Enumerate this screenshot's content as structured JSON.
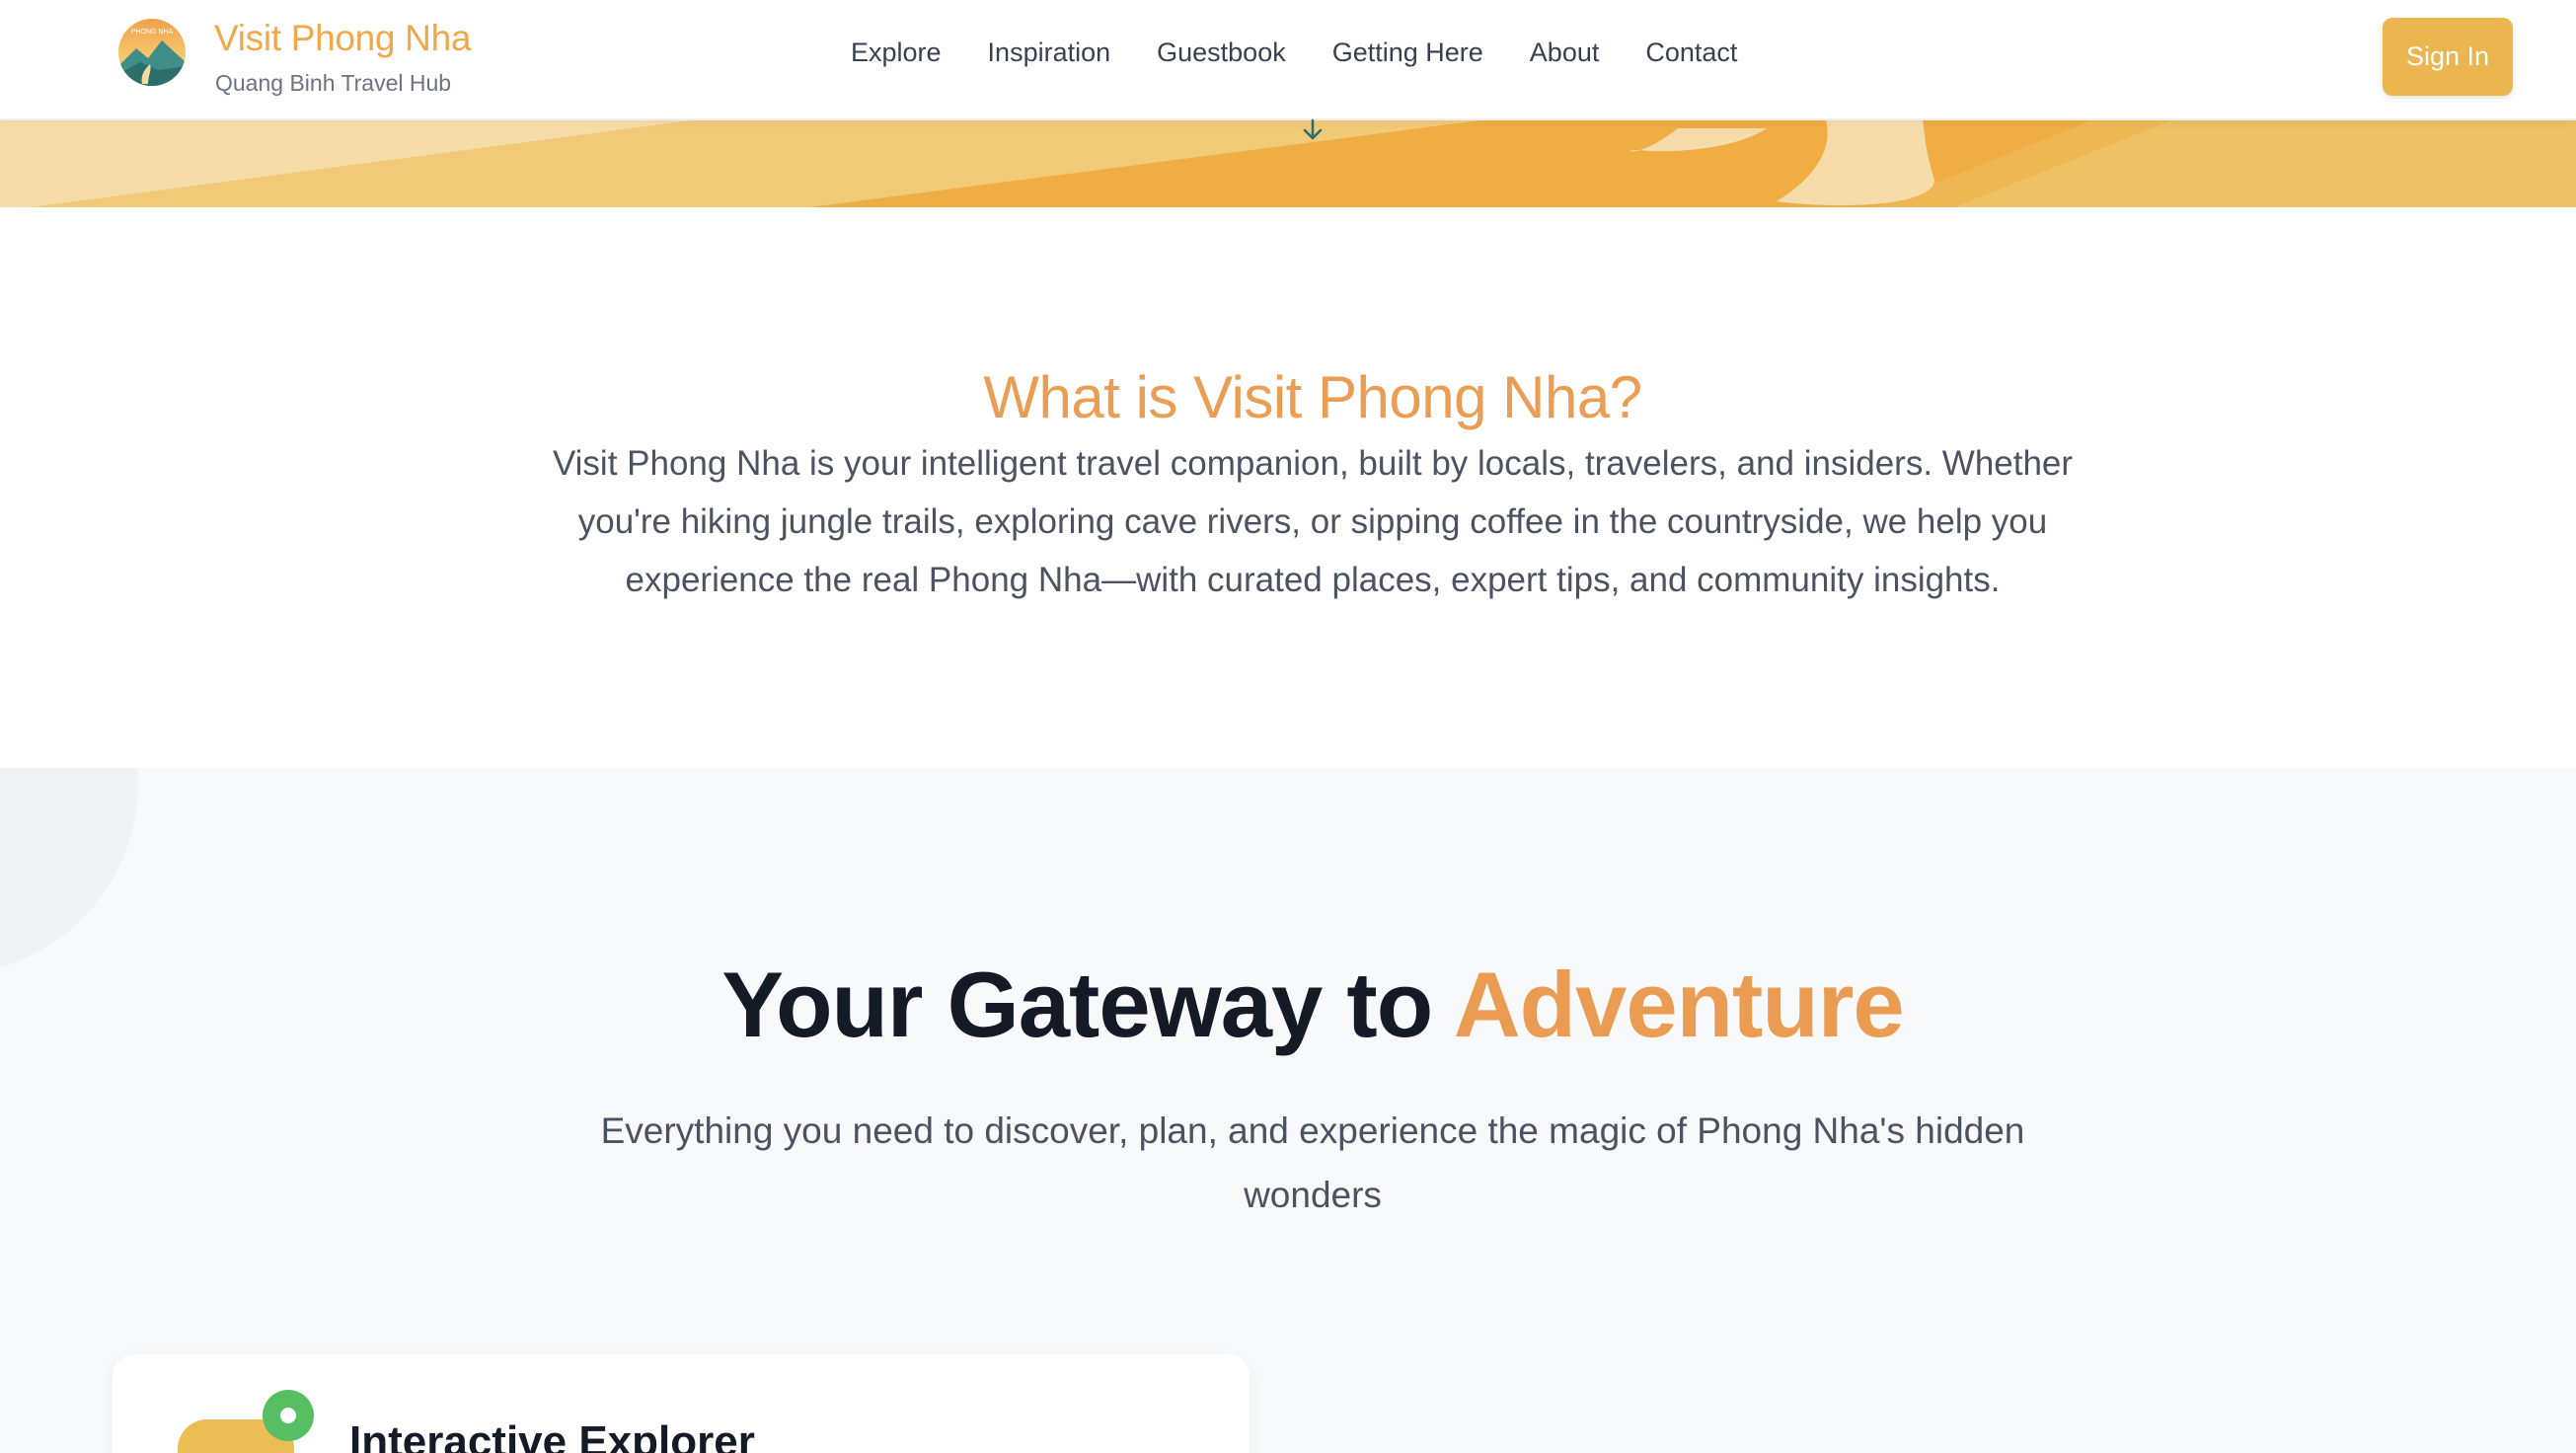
{
  "header": {
    "brand_title": "Visit Phong Nha",
    "brand_subtitle": "Quang Binh Travel Hub",
    "logo_text": "PHONG NHA",
    "nav": [
      "Explore",
      "Inspiration",
      "Guestbook",
      "Getting Here",
      "About",
      "Contact"
    ],
    "signin_label": "Sign In"
  },
  "about": {
    "title": "What is Visit Phong Nha?",
    "text": "Visit Phong Nha is your intelligent travel companion, built by locals, travelers, and insiders. Whether you're hiking jungle trails, exploring cave rivers, or sipping coffee in the countryside, we help you experience the real Phong Nha—with curated places, expert tips, and community insights."
  },
  "gateway": {
    "title_prefix": "Your Gateway to ",
    "title_accent": "Adventure",
    "subtitle": "Everything you need to discover, plan, and experience the magic of Phong Nha's hidden wonders",
    "card_title": "Interactive Explorer"
  },
  "colors": {
    "brand": "#efa84a",
    "accent": "#e99c52",
    "signin_bg": "#ebb64f",
    "card_dot": "#57bf62"
  }
}
